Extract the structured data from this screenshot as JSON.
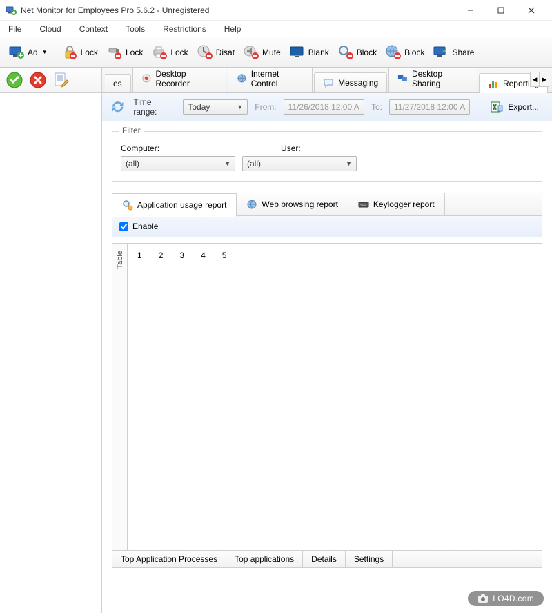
{
  "window": {
    "title": "Net Monitor for Employees Pro 5.6.2 - Unregistered"
  },
  "menu": [
    "File",
    "Cloud",
    "Context",
    "Tools",
    "Restrictions",
    "Help"
  ],
  "toolbar": [
    {
      "label": "Ad",
      "name": "add-button",
      "dropdown": true
    },
    {
      "label": "Lock",
      "name": "lock-padlock-button"
    },
    {
      "label": "Lock",
      "name": "lock-usb-button"
    },
    {
      "label": "Lock",
      "name": "lock-printer-button"
    },
    {
      "label": "Disat",
      "name": "disable-button"
    },
    {
      "label": "Mute",
      "name": "mute-button"
    },
    {
      "label": "Blank",
      "name": "blank-button"
    },
    {
      "label": "Block",
      "name": "block-search-button"
    },
    {
      "label": "Block",
      "name": "block-web-button"
    },
    {
      "label": "Share",
      "name": "share-button"
    }
  ],
  "mainTabs": {
    "partial": "es",
    "items": [
      {
        "label": "Desktop Recorder",
        "name": "tab-desktop-recorder"
      },
      {
        "label": "Internet Control",
        "name": "tab-internet-control"
      },
      {
        "label": "Messaging",
        "name": "tab-messaging"
      },
      {
        "label": "Desktop Sharing",
        "name": "tab-desktop-sharing"
      },
      {
        "label": "Reporting",
        "name": "tab-reporting",
        "active": true
      }
    ]
  },
  "timerange": {
    "label": "Time range:",
    "selected": "Today",
    "fromLabel": "From:",
    "fromValue": "11/26/2018 12:00 A",
    "toLabel": "To:",
    "toValue": "11/27/2018 12:00 A",
    "exportLabel": "Export..."
  },
  "filter": {
    "legend": "Filter",
    "computerLabel": "Computer:",
    "computerValue": "(all)",
    "userLabel": "User:",
    "userValue": "(all)"
  },
  "reportTabs": [
    {
      "label": "Application usage report",
      "name": "tab-app-usage",
      "active": true
    },
    {
      "label": "Web browsing report",
      "name": "tab-web-browsing"
    },
    {
      "label": "Keylogger report",
      "name": "tab-keylogger"
    }
  ],
  "enable": {
    "label": "Enable",
    "checked": true
  },
  "verticalTab": "Table",
  "columns": [
    "1",
    "2",
    "3",
    "4",
    "5"
  ],
  "bottomTabs": [
    "Top Application Processes",
    "Top applications",
    "Details",
    "Settings"
  ],
  "watermark": "LO4D.com"
}
